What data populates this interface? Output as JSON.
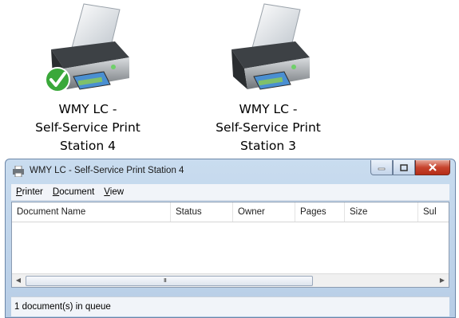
{
  "desktop_icons": [
    {
      "label": "WMY LC -\nSelf-Service Print\nStation  4",
      "default_printer": true
    },
    {
      "label": "WMY LC -\nSelf-Service Print\nStation 3",
      "default_printer": false
    }
  ],
  "window": {
    "title": "WMY LC - Self-Service Print Station 4",
    "menu": [
      {
        "accel": "P",
        "rest": "rinter"
      },
      {
        "accel": "D",
        "rest": "ocument"
      },
      {
        "accel": "V",
        "rest": "iew"
      }
    ],
    "columns": [
      "Document Name",
      "Status",
      "Owner",
      "Pages",
      "Size",
      "Sul"
    ],
    "status": "1 document(s) in queue",
    "scroll_grip": "III",
    "scroll_left": "◀",
    "scroll_right": "▶"
  },
  "colors": {
    "checkmark": "#3aa83a",
    "close_button": "#c7442e"
  }
}
